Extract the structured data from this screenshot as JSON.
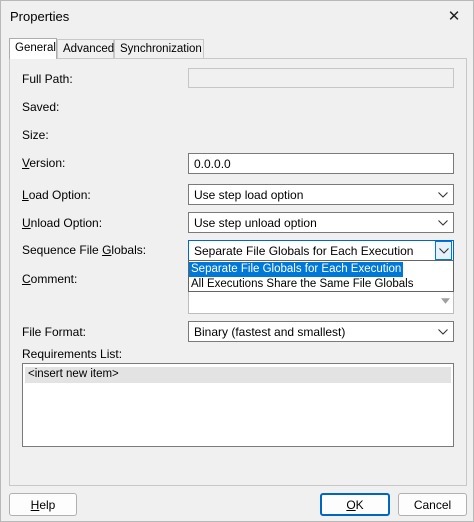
{
  "window": {
    "title": "Properties",
    "close_icon": "close-icon"
  },
  "tabs": [
    {
      "label": "General",
      "active": true
    },
    {
      "label": "Advanced",
      "active": false
    },
    {
      "label": "Synchronization",
      "active": false
    }
  ],
  "fields": {
    "full_path": {
      "label": "Full Path:",
      "value": ""
    },
    "saved": {
      "label": "Saved:"
    },
    "size": {
      "label": "Size:"
    },
    "version": {
      "label_mnemonic": "V",
      "label_rest": "ersion:",
      "value": "0.0.0.0"
    },
    "load_option": {
      "label_mnemonic": "L",
      "label_rest": "oad Option:",
      "value": "Use step load option"
    },
    "unload_option": {
      "label_mnemonic": "U",
      "label_rest": "nload Option:",
      "value": "Use step unload option"
    },
    "sequence_file_globals": {
      "label_pre": "Sequence File ",
      "label_mnemonic": "G",
      "label_rest": "lobals:",
      "value": "Separate File Globals for Each Execution",
      "options": [
        "Separate File Globals for Each Execution",
        "All Executions Share the Same File Globals"
      ],
      "selected_index": 0
    },
    "comment": {
      "label_mnemonic": "C",
      "label_rest": "omment:"
    },
    "file_format": {
      "label": "File Format:",
      "value": "Binary (fastest and smallest)"
    },
    "requirements_list": {
      "label": "Requirements List:",
      "items": [
        "<insert new item>"
      ]
    }
  },
  "buttons": {
    "help": {
      "mnemonic": "H",
      "rest": "elp"
    },
    "ok": {
      "mnemonic": "O",
      "rest": "K"
    },
    "cancel": {
      "label": "Cancel"
    }
  }
}
